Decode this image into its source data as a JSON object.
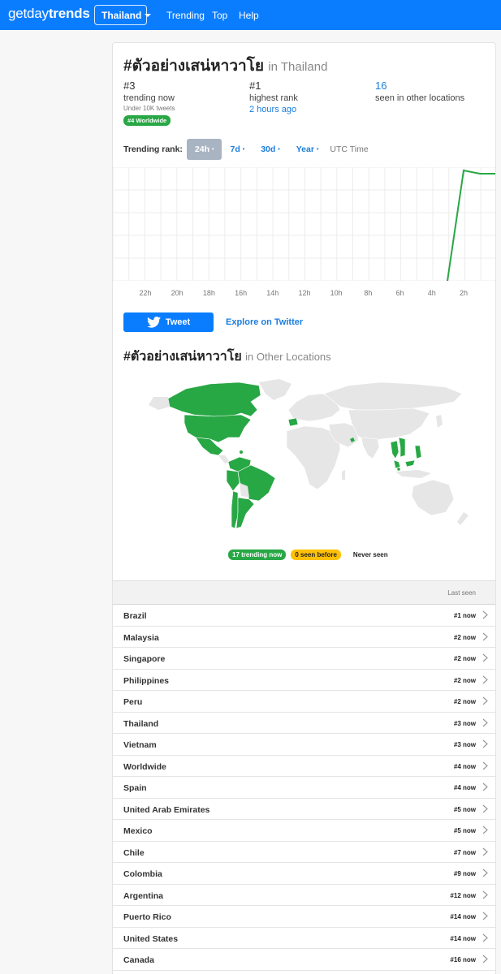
{
  "brand": {
    "prefix": "getday",
    "suffix": "trends"
  },
  "nav": {
    "country": "Thailand",
    "links": [
      "Trending",
      "Top",
      "Help"
    ]
  },
  "trend": {
    "name": "#ตัวอย่างเสน่หาวาโย",
    "location_suffix": "in Thailand",
    "other_locations_suffix": "in Other Locations"
  },
  "stats": {
    "current_rank": "#3",
    "current_label": "trending now",
    "tweet_volume": "Under 10K tweets",
    "worldwide_badge": "#4 Worldwide",
    "highest_rank": "#1",
    "highest_label": "highest rank",
    "highest_when": "2 hours ago",
    "locations_count": "16",
    "locations_label": "seen in other locations"
  },
  "rank_filter": {
    "label": "Trending rank:",
    "options": [
      "24h",
      "7d",
      "30d",
      "Year"
    ],
    "dot": "•",
    "timezone": "UTC Time"
  },
  "chart_data": {
    "type": "line",
    "title": "",
    "x": [
      "22h",
      "20h",
      "18h",
      "16h",
      "14h",
      "12h",
      "10h",
      "8h",
      "6h",
      "4h",
      "2h"
    ],
    "series": [
      {
        "values": [
          null,
          null,
          null,
          null,
          null,
          null,
          null,
          null,
          null,
          null,
          1
        ]
      }
    ],
    "ylim": [
      1,
      50
    ],
    "y_reversed": true,
    "color": "#28a745",
    "grid": true
  },
  "actions": {
    "tweet": "Tweet",
    "explore": "Explore on Twitter"
  },
  "map_legend": {
    "trending": "17 trending now",
    "seen_before": "0 seen before",
    "never": "Never seen"
  },
  "table": {
    "header": "Last seen",
    "rows": [
      {
        "country": "Brazil",
        "rank": "#1 now"
      },
      {
        "country": "Malaysia",
        "rank": "#2 now"
      },
      {
        "country": "Singapore",
        "rank": "#2 now"
      },
      {
        "country": "Philippines",
        "rank": "#2 now"
      },
      {
        "country": "Peru",
        "rank": "#2 now"
      },
      {
        "country": "Thailand",
        "rank": "#3 now"
      },
      {
        "country": "Vietnam",
        "rank": "#3 now"
      },
      {
        "country": "Worldwide",
        "rank": "#4 now"
      },
      {
        "country": "Spain",
        "rank": "#4 now"
      },
      {
        "country": "United Arab Emirates",
        "rank": "#5 now"
      },
      {
        "country": "Mexico",
        "rank": "#5 now"
      },
      {
        "country": "Chile",
        "rank": "#7 now"
      },
      {
        "country": "Colombia",
        "rank": "#9 now"
      },
      {
        "country": "Argentina",
        "rank": "#12 now"
      },
      {
        "country": "Puerto Rico",
        "rank": "#14 now"
      },
      {
        "country": "United States",
        "rank": "#14 now"
      },
      {
        "country": "Canada",
        "rank": "#16 now"
      }
    ]
  },
  "colors": {
    "brand_blue": "#0a7dff",
    "link_blue": "#1a7dde",
    "trending_green": "#28a745",
    "seen_yellow": "#ffc107",
    "map_gray": "#e6e6e6"
  }
}
